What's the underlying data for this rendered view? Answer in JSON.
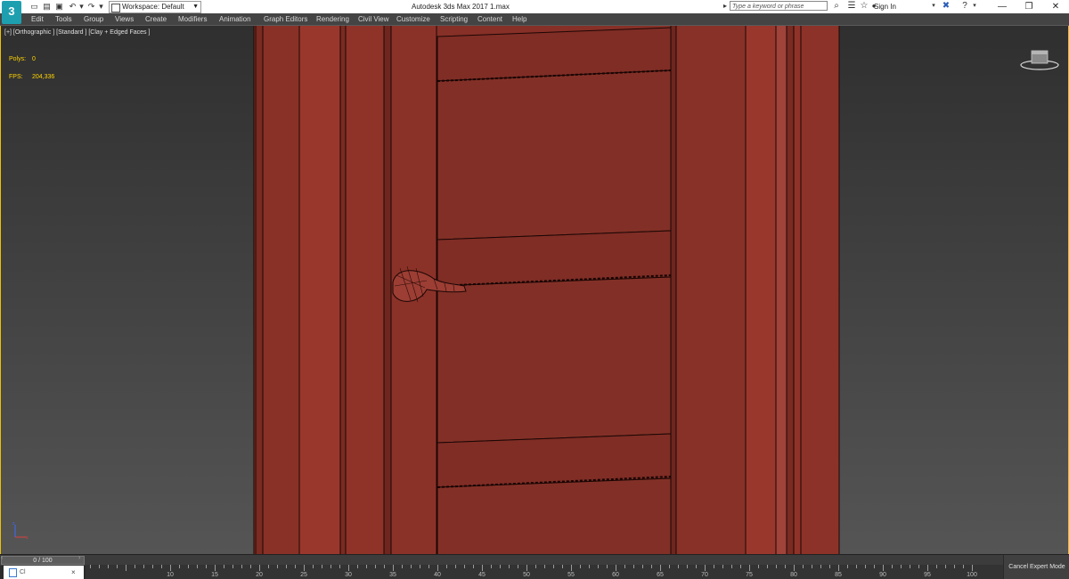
{
  "app": {
    "logo_text": "3",
    "window_title": "Autodesk 3ds Max 2017     1.max"
  },
  "quick_access": {
    "workspace_label": "Workspace: Default"
  },
  "infocenter": {
    "search_placeholder": "Type a keyword or phrase",
    "sign_in": "Sign In"
  },
  "window_controls": {
    "minimize": "—",
    "restore": "❐",
    "close": "✕"
  },
  "menu": [
    "Edit",
    "Tools",
    "Group",
    "Views",
    "Create",
    "Modifiers",
    "Animation",
    "Graph Editors",
    "Rendering",
    "Civil View",
    "Customize",
    "Scripting",
    "Content",
    "Help"
  ],
  "viewport": {
    "label": "[+] [Orthographic ] [Standard ] [Clay + Edged Faces ]",
    "stats": [
      {
        "label": "Polys:",
        "value": "0"
      },
      {
        "label": "FPS:",
        "value": "204,336"
      }
    ],
    "colors": {
      "door": "#8b3228",
      "door_dark": "#5e1f19",
      "edge": "#1b0604",
      "bg_top": "#2f2f2f",
      "bg_bottom": "#555555",
      "border": "#f0c000"
    }
  },
  "timeline": {
    "slider_label": "0 / 100",
    "ticks": [
      "10",
      "15",
      "20",
      "25",
      "30",
      "35",
      "40",
      "45",
      "50",
      "55",
      "60",
      "65",
      "70",
      "75",
      "80",
      "85",
      "90",
      "95",
      "100"
    ],
    "cancel_expert_mode": "Cancel Expert Mode"
  },
  "taskbar": {
    "item_label": "Cl",
    "close": "×"
  }
}
